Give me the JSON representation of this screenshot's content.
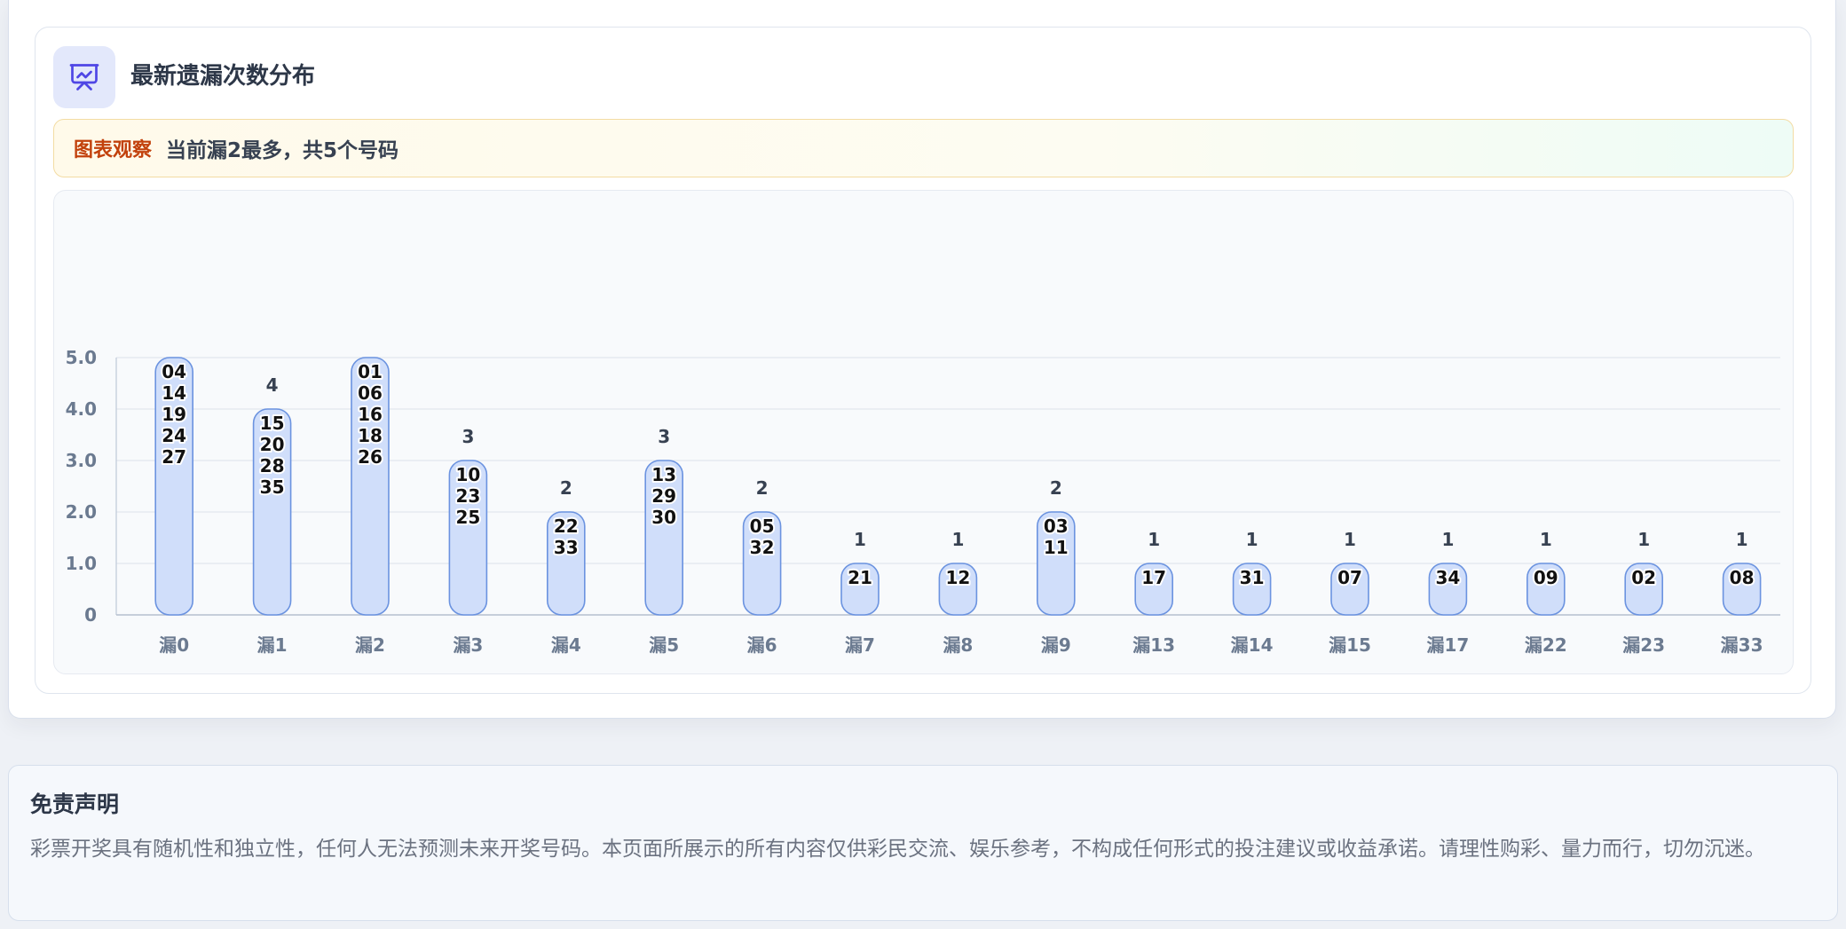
{
  "card": {
    "title": "最新遗漏次数分布",
    "icon": "chart-presentation-icon"
  },
  "insight": {
    "tag": "图表观察",
    "text": "当前漏2最多，共5个号码"
  },
  "chart_data": {
    "type": "bar",
    "categories": [
      "漏0",
      "漏1",
      "漏2",
      "漏3",
      "漏4",
      "漏5",
      "漏6",
      "漏7",
      "漏8",
      "漏9",
      "漏13",
      "漏14",
      "漏15",
      "漏17",
      "漏22",
      "漏23",
      "漏33"
    ],
    "values": [
      5,
      4,
      5,
      3,
      2,
      3,
      2,
      1,
      1,
      2,
      1,
      1,
      1,
      1,
      1,
      1,
      1
    ],
    "numbers": [
      [
        "04",
        "14",
        "19",
        "24",
        "27"
      ],
      [
        "15",
        "20",
        "28",
        "35"
      ],
      [
        "01",
        "06",
        "16",
        "18",
        "26"
      ],
      [
        "10",
        "23",
        "25"
      ],
      [
        "22",
        "33"
      ],
      [
        "13",
        "29",
        "30"
      ],
      [
        "05",
        "32"
      ],
      [
        "21"
      ],
      [
        "12"
      ],
      [
        "03",
        "11"
      ],
      [
        "17"
      ],
      [
        "31"
      ],
      [
        "07"
      ],
      [
        "34"
      ],
      [
        "09"
      ],
      [
        "02"
      ],
      [
        "08"
      ]
    ],
    "yticks": [
      "0",
      "1.0",
      "2.0",
      "3.0",
      "4.0",
      "5.0"
    ],
    "ylim": [
      0,
      5
    ],
    "grid": true,
    "colors": {
      "bar_fill": "#d0defa",
      "bar_stroke": "#6b93e0",
      "value_label": "#374151",
      "tick_label": "#6b7a90",
      "grid": "#e5e9f0"
    }
  },
  "disclaimer": {
    "title": "免责声明",
    "text": "彩票开奖具有随机性和独立性，任何人无法预测未来开奖号码。本页面所展示的所有内容仅供彩民交流、娱乐参考，不构成任何形式的投注建议或收益承诺。请理性购彩、量力而行，切勿沉迷。"
  }
}
